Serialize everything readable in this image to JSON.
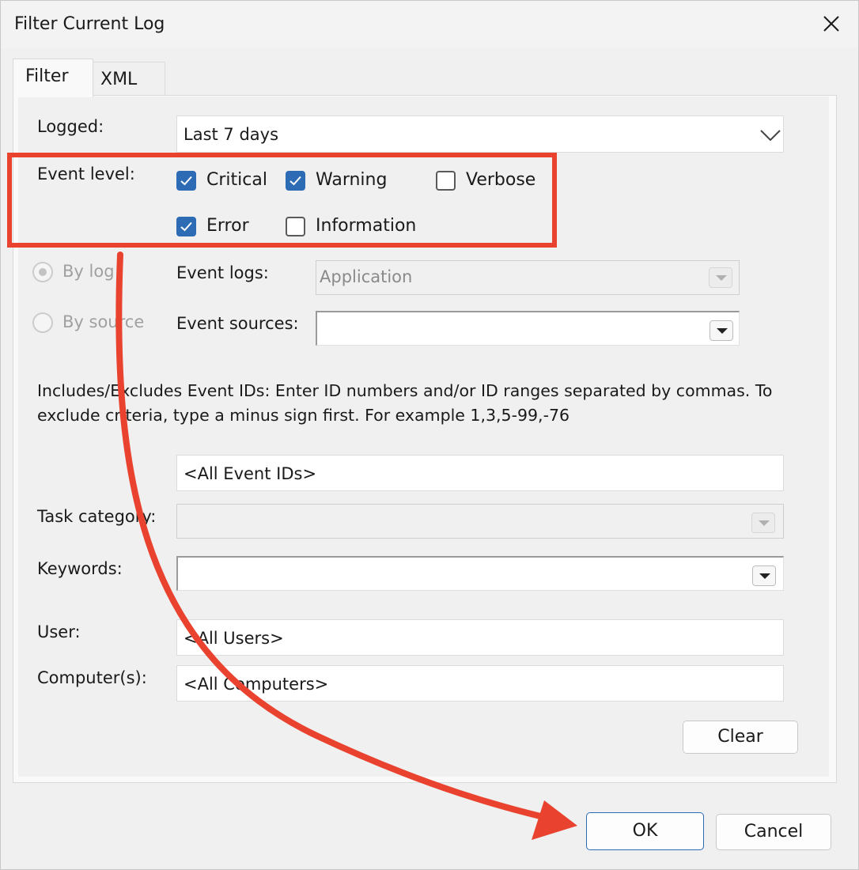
{
  "window": {
    "title": "Filter Current Log"
  },
  "tabs": [
    {
      "label": "Filter"
    },
    {
      "label": "XML"
    }
  ],
  "filter": {
    "logged": {
      "label": "Logged:",
      "value": "Last 7 days"
    },
    "event_level": {
      "label": "Event level:",
      "options": [
        {
          "label": "Critical",
          "checked": true
        },
        {
          "label": "Warning",
          "checked": true
        },
        {
          "label": "Verbose",
          "checked": false
        },
        {
          "label": "Error",
          "checked": true
        },
        {
          "label": "Information",
          "checked": false
        }
      ]
    },
    "scope": {
      "by_log": {
        "label": "By log",
        "selected": true,
        "enabled": false
      },
      "by_source": {
        "label": "By source",
        "selected": false,
        "enabled": false
      }
    },
    "event_logs": {
      "label": "Event logs:",
      "value": "Application"
    },
    "event_sources": {
      "label": "Event sources:",
      "value": ""
    },
    "event_ids_help": "Includes/Excludes Event IDs: Enter ID numbers and/or ID ranges separated by commas. To exclude criteria, type a minus sign first. For example 1,3,5-99,-76",
    "event_ids": {
      "value": "<All Event IDs>"
    },
    "task_category": {
      "label": "Task category:",
      "value": ""
    },
    "keywords": {
      "label": "Keywords:",
      "value": ""
    },
    "user": {
      "label": "User:",
      "value": "<All Users>"
    },
    "computers": {
      "label": "Computer(s):",
      "value": "<All Computers>"
    },
    "clear_label": "Clear"
  },
  "footer": {
    "ok_label": "OK",
    "cancel_label": "Cancel"
  },
  "annotation": {
    "highlight_color": "#e94330",
    "arrow_color": "#e94330"
  },
  "icons": [
    "close-icon",
    "checkmark-icon",
    "chevron-down-icon",
    "dropdown-arrow-icon",
    "annotation-arrow-icon"
  ]
}
